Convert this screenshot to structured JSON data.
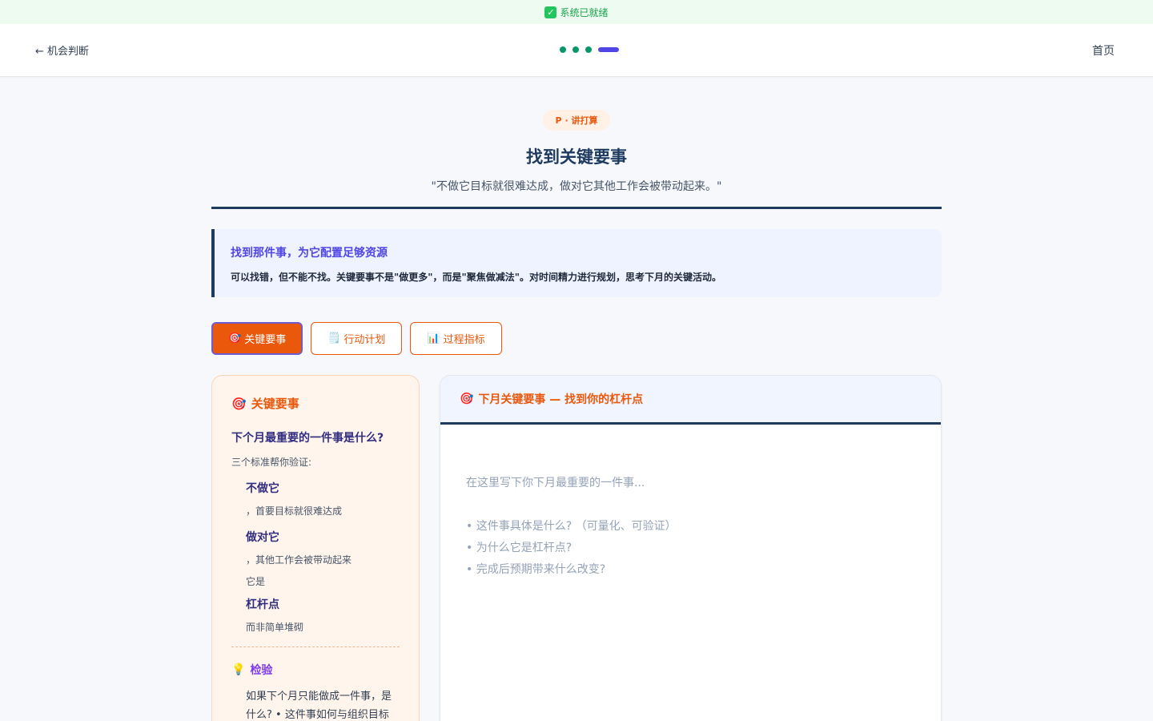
{
  "status": {
    "icon": "check-icon",
    "text": "系统已就绪"
  },
  "nav": {
    "back_label": "← 机会判断",
    "home_label": "首页",
    "steps_total": 4,
    "steps_current": 4
  },
  "header": {
    "badge": "P · 讲打算",
    "title": "找到关键要事",
    "quote": "\"不做它目标就很难达成，做对它其他工作会被带动起来。\""
  },
  "callout": {
    "title": "找到那件事，为它配置足够资源",
    "body": "可以找错，但不能不找。关键要事不是\"做更多\"，而是\"聚焦做减法\"。对时间精力进行规划，思考下月的关键活动。"
  },
  "tabs": [
    {
      "icon": "🎯",
      "label": "关键要事",
      "active": true
    },
    {
      "icon": "🗒️",
      "label": "行动计划",
      "active": false
    },
    {
      "icon": "📊",
      "label": "过程指标",
      "active": false
    }
  ],
  "sidebar": {
    "icon": "🎯",
    "title": "关键要事",
    "question": "下个月最重要的一件事是什么?",
    "subtitle": "三个标准帮你验证:",
    "criteria": [
      {
        "key": "不做它",
        "pre": "",
        "text": "，首要目标就很难达成"
      },
      {
        "key": "做对它",
        "pre": "",
        "text": "，其他工作会被带动起来"
      },
      {
        "key": "杠杆点",
        "pre": "它是",
        "text": "而非简单堆砌"
      }
    ],
    "check_icon": "💡",
    "check_title": "检验",
    "check_body": "如果下个月只能做成一件事，是什么? • 这件事如何与组织目标"
  },
  "main": {
    "icon": "🎯",
    "title": "下月关键要事 — 找到你的杠杆点",
    "placeholder_line": "在这里写下你下月最重要的一件事...",
    "placeholder_points": [
      "• 这件事具体是什么? （可量化、可验证）",
      "• 为什么它是杠杆点?",
      "• 完成后预期带来什么改变?"
    ]
  }
}
